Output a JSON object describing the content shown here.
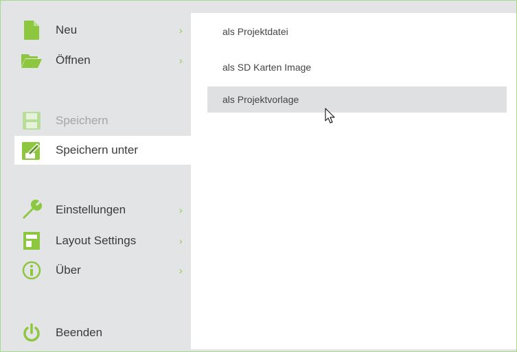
{
  "menu": {
    "items": [
      {
        "label": "Neu",
        "chevron": "›",
        "icon": "new-file-icon"
      },
      {
        "label": "Öffnen",
        "chevron": "›",
        "icon": "folder-open-icon"
      },
      {
        "label": "Speichern",
        "icon": "save-icon",
        "state": "disabled"
      },
      {
        "label": "Speichern unter",
        "icon": "save-as-icon",
        "state": "active"
      },
      {
        "label": "Einstellungen",
        "chevron": "›",
        "icon": "wrench-icon"
      },
      {
        "label": "Layout Settings",
        "chevron": "›",
        "icon": "layout-icon"
      },
      {
        "label": "Über",
        "chevron": "›",
        "icon": "info-icon"
      },
      {
        "label": "Beenden",
        "icon": "power-icon"
      }
    ]
  },
  "submenu": {
    "items": [
      {
        "label": "als Projektdatei"
      },
      {
        "label": "als SD Karten Image"
      },
      {
        "label": "als Projektvorlage",
        "state": "hover"
      }
    ]
  },
  "colors": {
    "accent": "#8dc63f",
    "sidebar_bg": "#e3e4e6",
    "panel_bg": "#ffffff",
    "hover_bg": "#dfe0e2",
    "disabled_text": "#a5a5a5"
  }
}
